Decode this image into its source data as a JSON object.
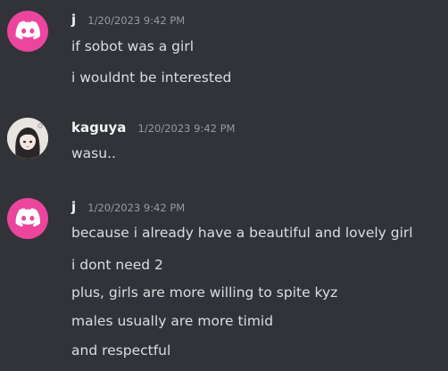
{
  "messages": [
    {
      "author": "j",
      "timestamp": "1/20/2023 9:42 PM",
      "avatar": "discord-logo-icon",
      "avatar_color": "#eb459e",
      "lines": [
        "if sobot was a girl",
        "i wouldnt be interested"
      ]
    },
    {
      "author": "kaguya",
      "timestamp": "1/20/2023 9:42 PM",
      "avatar": "anime-girl-avatar",
      "lines": [
        "wasu.."
      ]
    },
    {
      "author": "j",
      "timestamp": "1/20/2023 9:42 PM",
      "avatar": "discord-logo-icon",
      "avatar_color": "#eb459e",
      "lines": [
        "because i already have a beautiful and lovely girl",
        "i dont need 2",
        "plus, girls are more willing to spite kyz",
        "males usually are more timid",
        "and respectful"
      ]
    }
  ],
  "colors": {
    "background": "#313338",
    "username": "#f2f3f5",
    "timestamp": "#949ba4",
    "message_text": "#dbdee1"
  }
}
